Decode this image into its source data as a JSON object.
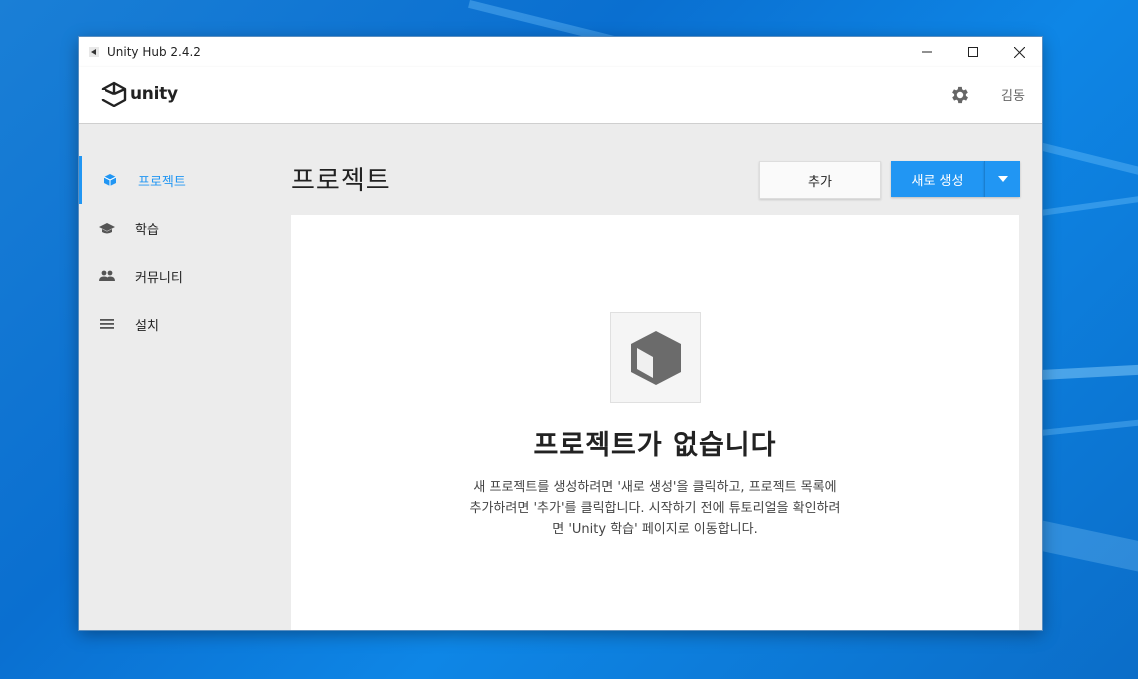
{
  "window": {
    "title": "Unity Hub 2.4.2",
    "minimize": "—",
    "maximize": "☐",
    "close": "✕"
  },
  "header": {
    "logo_text": "unity",
    "user": "김동"
  },
  "sidebar": {
    "items": [
      {
        "label": "프로젝트",
        "icon": "cube-icon",
        "active": true
      },
      {
        "label": "학습",
        "icon": "graduation-cap-icon",
        "active": false
      },
      {
        "label": "커뮤니티",
        "icon": "people-icon",
        "active": false
      },
      {
        "label": "설치",
        "icon": "list-icon",
        "active": false
      }
    ]
  },
  "main": {
    "title": "프로젝트",
    "add_label": "추가",
    "new_label": "새로 생성",
    "empty_title": "프로젝트가 없습니다",
    "empty_desc_1": "새 프로젝트를 생성하려면 '새로 생성'을 클릭하고, 프로젝트 목록에",
    "empty_desc_2": "추가하려면 '추가'를 클릭합니다. 시작하기 전에 튜토리얼을 확인하려",
    "empty_desc_3": "면 'Unity 학습' 페이지로 이동합니다."
  },
  "colors": {
    "accent": "#2196f3",
    "sidebar_bg": "#ececec",
    "text": "#222222"
  }
}
